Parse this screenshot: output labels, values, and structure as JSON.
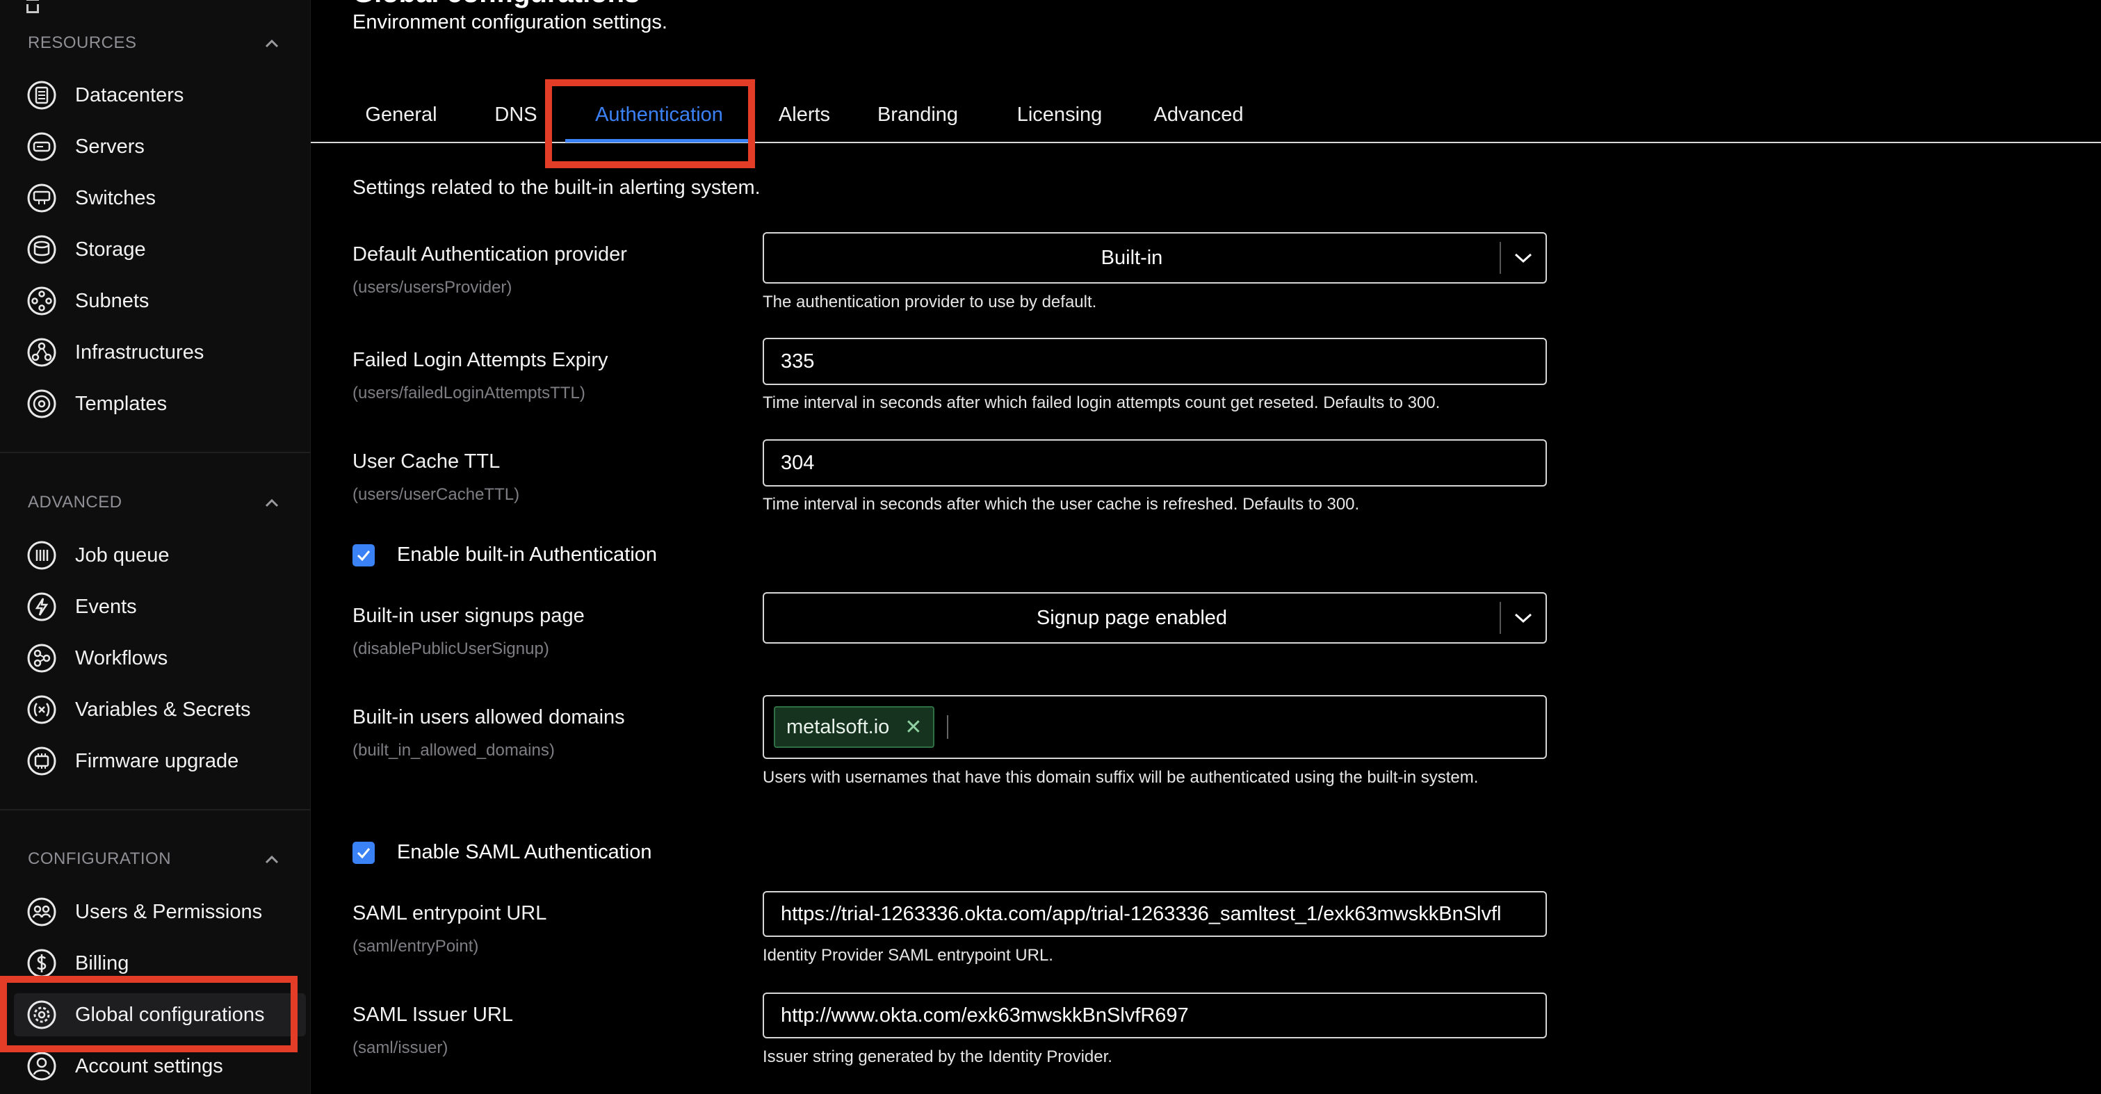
{
  "sidebar": {
    "sections": [
      {
        "title": "RESOURCES",
        "items": [
          {
            "label": "Datacenters",
            "icon": "datacenter-icon"
          },
          {
            "label": "Servers",
            "icon": "server-icon"
          },
          {
            "label": "Switches",
            "icon": "switch-icon"
          },
          {
            "label": "Storage",
            "icon": "storage-icon"
          },
          {
            "label": "Subnets",
            "icon": "subnet-icon"
          },
          {
            "label": "Infrastructures",
            "icon": "infrastructure-icon"
          },
          {
            "label": "Templates",
            "icon": "template-icon"
          }
        ]
      },
      {
        "title": "ADVANCED",
        "items": [
          {
            "label": "Job queue",
            "icon": "job-queue-icon"
          },
          {
            "label": "Events",
            "icon": "events-icon"
          },
          {
            "label": "Workflows",
            "icon": "workflow-icon"
          },
          {
            "label": "Variables & Secrets",
            "icon": "variables-icon"
          },
          {
            "label": "Firmware upgrade",
            "icon": "firmware-icon"
          }
        ]
      },
      {
        "title": "CONFIGURATION",
        "items": [
          {
            "label": "Users & Permissions",
            "icon": "users-icon"
          },
          {
            "label": "Billing",
            "icon": "billing-icon"
          },
          {
            "label": "Global configurations",
            "icon": "gear-icon",
            "active": true
          },
          {
            "label": "Account settings",
            "icon": "account-icon"
          }
        ]
      }
    ]
  },
  "page": {
    "title": "Global configurations",
    "subtitle": "Environment configuration settings."
  },
  "tabs": [
    {
      "label": "General"
    },
    {
      "label": "DNS"
    },
    {
      "label": "Authentication",
      "active": true
    },
    {
      "label": "Alerts"
    },
    {
      "label": "Branding"
    },
    {
      "label": "Licensing"
    },
    {
      "label": "Advanced"
    }
  ],
  "form": {
    "description": "Settings related to the built-in alerting system.",
    "default_provider": {
      "label": "Default Authentication provider",
      "key": "(users/usersProvider)",
      "value": "Built-in",
      "help": "The authentication provider to use by default."
    },
    "failed_login": {
      "label": "Failed Login Attempts Expiry",
      "key": "(users/failedLoginAttemptsTTL)",
      "value": "335",
      "help": "Time interval in seconds after which failed login attempts count get reseted. Defaults to 300."
    },
    "user_cache": {
      "label": "User Cache TTL",
      "key": "(users/userCacheTTL)",
      "value": "304",
      "help": "Time interval in seconds after which the user cache is refreshed. Defaults to 300."
    },
    "enable_builtin": {
      "label": "Enable built-in Authentication",
      "checked": true
    },
    "signups_page": {
      "label": "Built-in user signups page",
      "key": "(disablePublicUserSignup)",
      "value": "Signup page enabled"
    },
    "allowed_domains": {
      "label": "Built-in users allowed domains",
      "key": "(built_in_allowed_domains)",
      "tags": [
        "metalsoft.io"
      ],
      "help": "Users with usernames that have this domain suffix will be authenticated using the built-in system."
    },
    "enable_saml": {
      "label": "Enable SAML Authentication",
      "checked": true
    },
    "saml_entrypoint": {
      "label": "SAML entrypoint URL",
      "key": "(saml/entryPoint)",
      "value": "https://trial-1263336.okta.com/app/trial-1263336_samltest_1/exk63mwskkBnSlvfl",
      "help": "Identity Provider SAML entrypoint URL."
    },
    "saml_issuer": {
      "label": "SAML Issuer URL",
      "key": "(saml/issuer)",
      "value": "http://www.okta.com/exk63mwskkBnSlvfR697",
      "help": "Issuer string generated by the Identity Provider."
    }
  },
  "colors": {
    "accent": "#3b82f6",
    "highlight": "#e33d27",
    "tag_bg": "#16331f"
  }
}
